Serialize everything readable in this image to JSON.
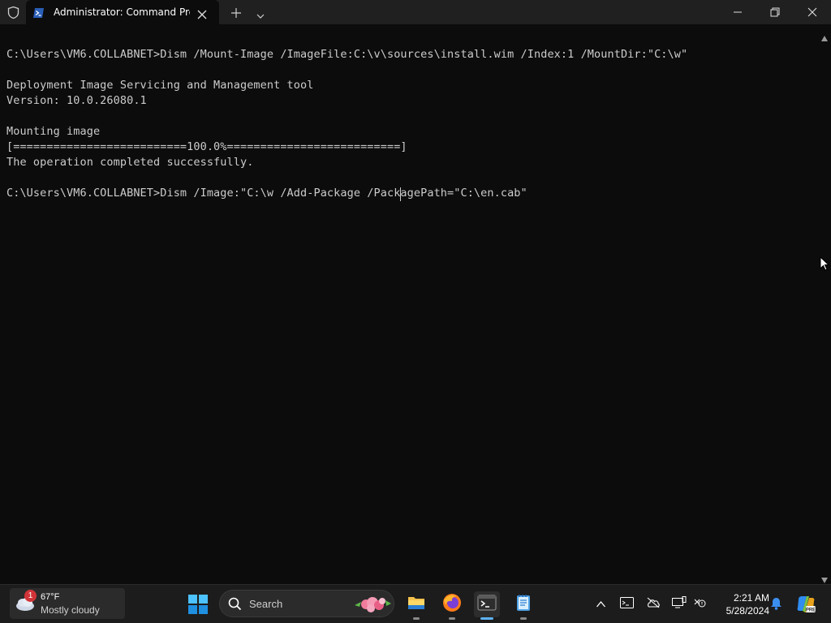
{
  "window": {
    "tab_title": "Administrator: Command Prc",
    "icons": [
      "shield-icon",
      "powershell-icon",
      "close-icon",
      "plus-icon",
      "chevron-down-icon",
      "minimize-icon",
      "maximize-icon",
      "close-icon"
    ]
  },
  "console": {
    "lines": [
      "C:\\Users\\VM6.COLLABNET>Dism /Mount-Image /ImageFile:C:\\v\\sources\\install.wim /Index:1 /MountDir:\"C:\\w\"",
      "",
      "Deployment Image Servicing and Management tool",
      "Version: 10.0.26080.1",
      "",
      "Mounting image",
      "[==========================100.0%==========================]",
      "The operation completed successfully.",
      "",
      "C:\\Users\\VM6.COLLABNET>Dism /Image:\"C:\\w /Add-Package /PackagePath=\"C:\\en.cab\""
    ],
    "colors": {
      "background": "#0c0c0c",
      "text": "#cccccc"
    }
  },
  "taskbar": {
    "weather": {
      "temp": "67°F",
      "description": "Mostly cloudy",
      "badge": "1"
    },
    "search": {
      "placeholder": "Search"
    },
    "apps": [
      "file-explorer-icon",
      "firefox-icon",
      "terminal-icon",
      "notepad-icon"
    ],
    "tray": [
      "chevron-up-icon",
      "terminal-tray-icon",
      "cloud-offline-icon",
      "display-icon",
      "network-icon",
      "bell-icon",
      "copilot-icon"
    ],
    "clock": {
      "time": "2:21 AM",
      "date": "5/28/2024"
    },
    "accent": "#5fb2f2"
  }
}
